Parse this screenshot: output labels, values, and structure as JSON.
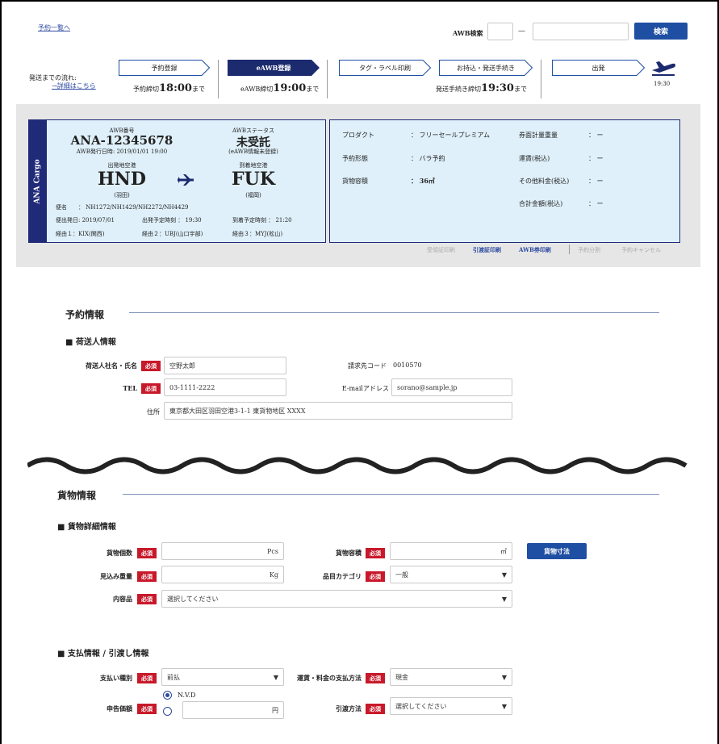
{
  "top": {
    "back_link": "予約一覧へ",
    "awb_search_label": "AWB検索",
    "dash": "—",
    "search_button": "検索"
  },
  "flow": {
    "label": "発送までの流れ:",
    "detail_link": "→詳細はこちら",
    "steps": [
      {
        "label": "予約登録",
        "deadline_prefix": "予約締切",
        "deadline_time": "18:00",
        "deadline_suffix": "まで"
      },
      {
        "label": "eAWB登録",
        "deadline_prefix": "eAWB締切",
        "deadline_time": "19:00",
        "deadline_suffix": "まで"
      },
      {
        "label": "タグ・ラベル印刷"
      },
      {
        "label": "お持込・発送手続き",
        "deadline_prefix": "発送手続き締切",
        "deadline_time": "19:30",
        "deadline_suffix": "まで"
      },
      {
        "label": "出発"
      }
    ],
    "depart_time": "19:30"
  },
  "card": {
    "brand": "ANA Cargo",
    "awb_label": "AWB番号",
    "awb_number": "ANA-12345678",
    "awb_issue": "AWB発行日時: 2019/01/01 19:00",
    "status_label": "AWBステータス",
    "status_value": "未受託",
    "status_note": "(eAWB情報未登録)",
    "origin_label": "出発地空港",
    "origin_code": "HND",
    "origin_name": "(羽田)",
    "dest_label": "到着地空港",
    "dest_code": "FUK",
    "dest_name": "(福岡)",
    "flight_label": "便名",
    "flight_value": "： NH1272/NH1429/NH2272/NH4429",
    "dep_date": "便出発日: 2019/07/01",
    "dep_time": "出発予定時刻 ： 19:30",
    "arr_time": "到着予定時刻 ： 21:20",
    "via1": "経由１：KIX(関西)",
    "via2": "経由２：UBJ(山口宇部)",
    "via3": "経由３：MYJ(松山)"
  },
  "info": {
    "product_label": "プロダクト",
    "product_value": "： フリーセールプレミアム",
    "booking_label": "予約形態",
    "booking_value": "： バラ予約",
    "volume_label": "貨物容積",
    "volume_value": "： 36㎥",
    "chargeable_label": "券面計量重量",
    "chargeable_value": "： ー",
    "fare_label": "運賃(税込)",
    "fare_value": "： ー",
    "other_label": "その他料金(税込)",
    "other_value": "： ー",
    "total_label": "合計金額(税込)",
    "total_value": "： ー"
  },
  "actions": {
    "receipt": "受領証印刷",
    "handover": "引渡証印刷",
    "awb_print": "AWB券印刷",
    "split": "予約分割",
    "cancel": "予約キャンセル"
  },
  "reservation": {
    "title": "予約情報",
    "shipper_title": "■ 荷送人情報",
    "name_label": "荷送人社名・氏名",
    "name_value": "空野太郎",
    "billing_label": "請求先コード",
    "billing_value": "0010570",
    "tel_label": "TEL",
    "tel_value": "03-1111-2222",
    "email_label": "E-mailアドレス",
    "email_value": "sorano@sample.jp",
    "address_label": "住所",
    "address_value": "東京都大田区羽田空港3-1-1 東貨物地区 XXXX"
  },
  "required": "必須",
  "cargo": {
    "title": "貨物情報",
    "detail_title": "■ 貨物詳細情報",
    "count_label": "貨物個数",
    "count_unit": "Pcs",
    "volume_label": "貨物容積",
    "volume_unit": "㎥",
    "dimension_button": "貨物寸法",
    "weight_label": "見込み重量",
    "weight_unit": "Kg",
    "category_label": "品目カテゴリ",
    "category_value": "一般",
    "contents_label": "内容品",
    "contents_value": "選択してください"
  },
  "payment": {
    "title": "■ 支払情報 / 引渡し情報",
    "type_label": "支払い種別",
    "type_value": "前払",
    "method_label": "運賃・料金の支払方法",
    "method_value": "現金",
    "declared_label": "申告価額",
    "nvd_label": "N.V.D",
    "yen_unit": "円",
    "delivery_label": "引渡方法",
    "delivery_value": "選択してください"
  }
}
